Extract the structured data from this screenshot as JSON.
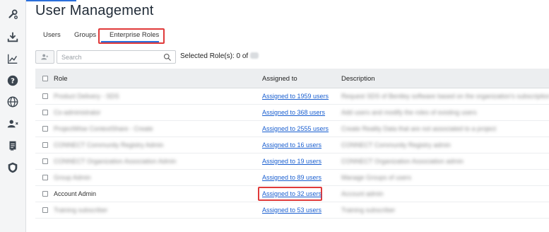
{
  "page": {
    "title": "User Management"
  },
  "tabs": [
    {
      "label": "Users",
      "active": false
    },
    {
      "label": "Groups",
      "active": false
    },
    {
      "label": "Enterprise Roles",
      "active": true
    }
  ],
  "toolbar": {
    "search_placeholder": "Search",
    "selected_label": "Selected Role(s): 0 of"
  },
  "table": {
    "headers": {
      "role": "Role",
      "assigned": "Assigned to",
      "description": "Description"
    },
    "rows": [
      {
        "role": "Product Delivery - SDS",
        "assigned": "Assigned to 1959 users",
        "description": "Request SDS of Bentley software based on the organization's subscription p...",
        "role_blurred": true
      },
      {
        "role": "Co-administrator",
        "assigned": "Assigned to 368 users",
        "description": "Add users and modify the roles of existing users",
        "role_blurred": true
      },
      {
        "role": "ProjectWise ContextShare - Create",
        "assigned": "Assigned to 2555 users",
        "description": "Create Reality Data that are not associated to a project",
        "role_blurred": true
      },
      {
        "role": "CONNECT Community Registry Admin",
        "assigned": "Assigned to 16 users",
        "description": "CONNECT Community Registry admin",
        "role_blurred": true
      },
      {
        "role": "CONNECT Organization Association Admin",
        "assigned": "Assigned to 19 users",
        "description": "CONNECT Organization Association admin",
        "role_blurred": true
      },
      {
        "role": "Group Admin",
        "assigned": "Assigned to 89 users",
        "description": "Manage Groups of users",
        "role_blurred": true
      },
      {
        "role": "Account Admin",
        "assigned": "Assigned to 32 users",
        "description": "Account admin",
        "role_blurred": false
      },
      {
        "role": "Training subscriber",
        "assigned": "Assigned to 53 users",
        "description": "Training subscriber",
        "role_blurred": true
      }
    ]
  },
  "colors": {
    "accent": "#2a6fdb",
    "highlight": "#e03a3a",
    "link": "#1a5fd0"
  }
}
